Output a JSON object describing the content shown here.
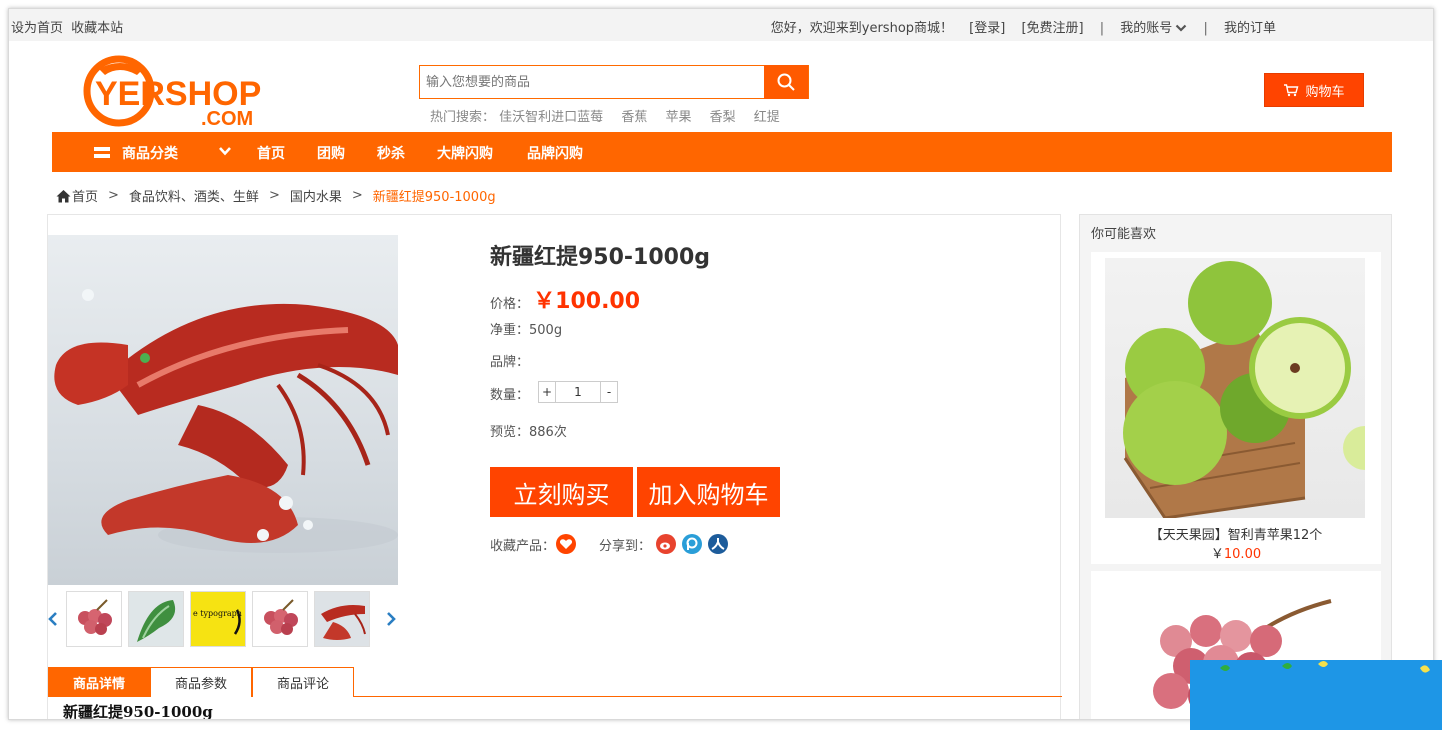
{
  "topbar": {
    "set_home": "设为首页",
    "bookmark": "收藏本站",
    "welcome": "您好，欢迎来到yershop商城！",
    "login": "[登录]",
    "register": "[免费注册]",
    "divider": "|",
    "account": "我的账号",
    "orders": "我的订单"
  },
  "logo": {
    "main": "YERSHOP",
    "sub": ".COM"
  },
  "search": {
    "placeholder": "输入您想要的商品",
    "hot_label": "热门搜索：",
    "hot_terms": [
      "佳沃智利进口蓝莓",
      "香蕉",
      "苹果",
      "香梨",
      "红提"
    ]
  },
  "cart": {
    "label": "购物车"
  },
  "nav": {
    "category": "商品分类",
    "items": [
      "首页",
      "团购",
      "秒杀",
      "大牌闪购",
      "品牌闪购"
    ]
  },
  "breadcrumb": {
    "home": "首页",
    "sep": ">",
    "level1": "食品饮料、酒类、生鲜",
    "level2": "国内水果",
    "current": "新疆红提950-1000g"
  },
  "product": {
    "name": "新疆红提950-1000g",
    "price_label": "价格：",
    "price": "￥100.00",
    "weight": "净重：500g",
    "brand": "品牌：",
    "qty_label": "数量：",
    "qty_plus": "+",
    "qty_value": "1",
    "qty_minus": "-",
    "views": "预览：886次",
    "buy_now": "立刻购买",
    "add_cart": "加入购物车",
    "favorite_label": "收藏产品：",
    "share_label": "分享到：",
    "thumb_text": "e typograph"
  },
  "tabs": [
    "商品详情",
    "商品参数",
    "商品评论"
  ],
  "description_title": "新疆红提950-1000g",
  "sidebar": {
    "title": "你可能喜欢",
    "items": [
      {
        "name": "【天天果园】智利青苹果12个",
        "currency": "￥",
        "price": "10.00"
      }
    ]
  },
  "colors": {
    "accent": "#ff6600",
    "price": "#ff3300",
    "button": "#ff4400"
  }
}
